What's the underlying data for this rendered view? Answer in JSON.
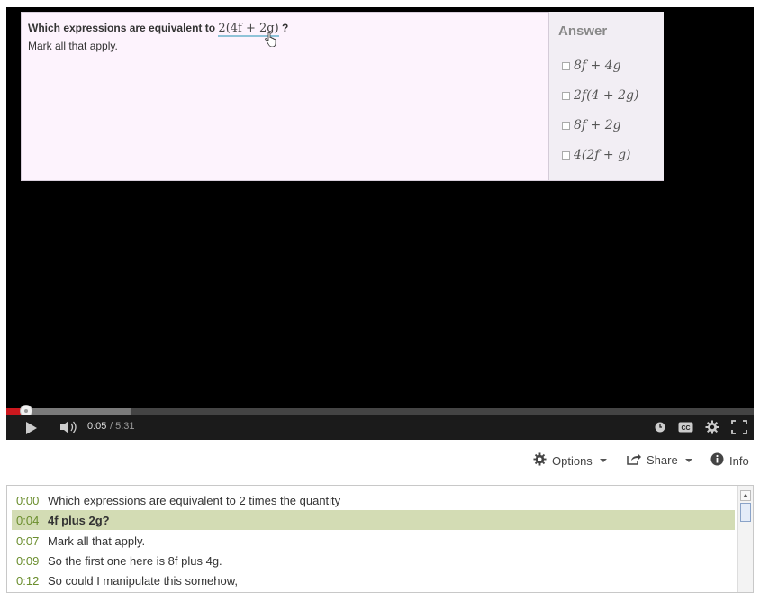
{
  "question": {
    "prefix": "Which expressions are equivalent to ",
    "expr_coef": "2",
    "expr_rest": "(4f + 2g)",
    "suffix": " ?",
    "subtext": "Mark all that apply."
  },
  "answer": {
    "title": "Answer",
    "options": [
      "8f + 4g",
      "2f(4 + 2g)",
      "8f + 2g",
      "4(2f + g)"
    ]
  },
  "player": {
    "time_current": "0:05",
    "time_total": " / 5:31",
    "progress_played": 0.027,
    "progress_loaded": 0.168
  },
  "toolbar": {
    "options_label": "Options",
    "share_label": "Share",
    "info_label": "Info"
  },
  "transcript": [
    {
      "time": "0:00",
      "text": "Which expressions are equivalent to 2 times the quantity",
      "active": false
    },
    {
      "time": "0:04",
      "text": "4f plus 2g?",
      "active": true
    },
    {
      "time": "0:07",
      "text": "Mark all that apply.",
      "active": false
    },
    {
      "time": "0:09",
      "text": "So the first one here is 8f plus 4g.",
      "active": false
    },
    {
      "time": "0:12",
      "text": "So could I manipulate this somehow,",
      "active": false
    }
  ],
  "icons": {
    "play": "play-icon",
    "volume": "volume-icon",
    "clock": "clock-icon",
    "cc": "closed-captions-icon",
    "settings": "gear-icon",
    "fullscreen": "fullscreen-icon",
    "options": "gear-icon",
    "share": "share-icon",
    "info": "info-icon"
  }
}
